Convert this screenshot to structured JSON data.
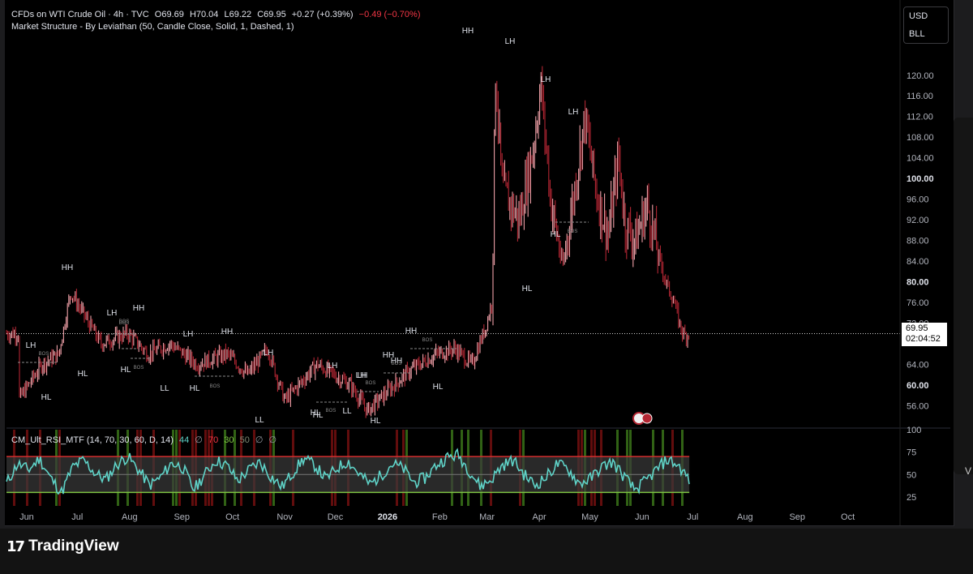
{
  "header": {
    "symbol": "CFDs on WTI Crude Oil · 4h · TVC",
    "open_label": "O",
    "open": "69.69",
    "high_label": "H",
    "high": "70.04",
    "low_label": "L",
    "low": "69.22",
    "close_label": "C",
    "close": "69.95",
    "change": "+0.27 (+0.39%)",
    "change2": "−0.49 (−0.70%)",
    "indicator1": "Market Structure - By Leviathan (50, Candle Close, Solid, 1, Dashed, 1)",
    "indicator2_name": "CM_Ult_RSI_MTF (14, 70, 30, 60, D, 14)",
    "indicator2_values": [
      "44",
      "∅",
      "70",
      "30",
      "50",
      "∅",
      "∅"
    ]
  },
  "currency_menu": [
    "USD",
    "BLL"
  ],
  "price_label": {
    "price": "69.95",
    "timer": "02:04:52"
  },
  "footer": {
    "brand": "TradingView"
  },
  "side_letter": "V",
  "colors": {
    "candle_up": "#f0a0a8",
    "candle_down": "#b32633",
    "rsi_line": "#5fd3c8",
    "overbought": "#d32f2f",
    "oversold": "#7cc242",
    "change_pos": "#e0e3eb",
    "change_neg": "#f23645"
  },
  "chart_data": [
    {
      "type": "line",
      "title": "CFDs on WTI Crude Oil · 4h · TVC",
      "y_ticks": [
        56,
        60,
        64,
        72,
        76,
        80,
        84,
        88,
        92,
        96,
        100,
        104,
        108,
        112,
        116,
        120
      ],
      "y_tick_labels": [
        "56.00",
        "60.00",
        "64.00",
        "72.00",
        "76.00",
        "80.00",
        "84.00",
        "88.00",
        "92.00",
        "96.00",
        "100.00",
        "104.00",
        "108.00",
        "112.00",
        "116.00",
        "120.00"
      ],
      "ylim": [
        52.6,
        126.4
      ],
      "x_tick_labels": [
        "Jun",
        "Jul",
        "Aug",
        "Sep",
        "Oct",
        "Nov",
        "Dec",
        "2026",
        "Feb",
        "Mar",
        "Apr",
        "May",
        "Jun",
        "Jul",
        "Aug",
        "Sep",
        "Oct"
      ],
      "x": [
        "2025-05-27",
        "2025-06-10",
        "2025-06-20",
        "2025-06-27",
        "2025-07-15",
        "2025-07-31",
        "2025-08-12",
        "2025-08-25",
        "2025-09-10",
        "2025-09-28",
        "2025-10-10",
        "2025-10-22",
        "2025-11-01",
        "2025-11-20",
        "2025-12-10",
        "2025-12-20",
        "2026-01-05",
        "2026-01-15",
        "2026-01-30",
        "2026-02-10",
        "2026-02-20",
        "2026-02-28",
        "2026-03-04",
        "2026-03-06",
        "2026-03-10",
        "2026-03-20",
        "2026-03-28",
        "2026-04-02",
        "2026-04-08",
        "2026-04-15",
        "2026-04-22",
        "2026-04-28",
        "2026-05-05",
        "2026-05-12",
        "2026-05-18",
        "2026-05-22",
        "2026-05-28",
        "2026-06-04",
        "2026-06-10",
        "2026-06-15",
        "2026-06-20",
        "2026-06-23",
        "2026-06-26",
        "2026-06-29"
      ],
      "series": [
        {
          "values": [
            57,
            64,
            66,
            78,
            68,
            70,
            66,
            68,
            64,
            66,
            62,
            67,
            57,
            64,
            60,
            55,
            60,
            63,
            66,
            67,
            64,
            71,
            76,
            121,
            98,
            92,
            105,
            118,
            95,
            83,
            98,
            112,
            97,
            89,
            104,
            91,
            88,
            95,
            86,
            80,
            76,
            72,
            69.5,
            69.95
          ]
        }
      ],
      "last_price": 69.95,
      "annotations": [
        "HH",
        "LH",
        "LH",
        "HH",
        "LH",
        "HH",
        "LH",
        "HL",
        "HL",
        "LL",
        "HL",
        "HL",
        "LL",
        "HL",
        "LH",
        "LH",
        "HH",
        "HH",
        "LL",
        "HL",
        "HL",
        "LH",
        "LH",
        "LH",
        "HL",
        "HL",
        "HL",
        "HL",
        "HL",
        "LL"
      ],
      "bos_labels": [
        "BOS",
        "BOS",
        "BOS",
        "BOS",
        "BOS",
        "BOS",
        "BOS",
        "BOS",
        "BOS",
        "BOS"
      ]
    },
    {
      "type": "line",
      "title": "CM_Ult_RSI_MTF (14, 70, 30, 60, D, 14)",
      "y_ticks": [
        25,
        50,
        75,
        100
      ],
      "y_tick_labels": [
        "25",
        "50",
        "75",
        "100"
      ],
      "ylim": [
        15,
        100
      ],
      "levels": [
        70,
        30,
        50
      ],
      "series": [
        {
          "values": [
            40,
            62,
            55,
            68,
            46,
            30,
            58,
            66,
            52,
            44,
            61,
            70,
            55,
            38,
            47,
            63,
            58,
            33,
            50,
            66,
            60,
            43,
            55,
            64,
            48,
            36,
            52,
            68,
            60,
            45,
            57,
            65,
            51,
            39,
            49,
            62,
            57,
            41,
            46,
            60,
            69,
            72,
            55,
            37,
            44,
            60,
            66,
            50,
            38,
            47,
            62,
            56,
            40,
            45,
            58,
            64,
            49,
            33,
            42,
            55,
            67,
            60,
            44
          ]
        }
      ]
    }
  ]
}
